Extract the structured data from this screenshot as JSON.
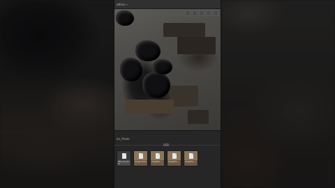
{
  "window": {
    "title": "athira ~"
  },
  "strip": {
    "label": "ito_Photo"
  },
  "thumbnails": [
    {
      "caption": "IMG_Cap_Phot"
    },
    {
      "caption": "Image_Photo ..."
    },
    {
      "caption": "ImageFile ..."
    },
    {
      "caption": "ImageFile ..."
    },
    {
      "caption": "ImageFile ..."
    }
  ],
  "icons": [
    "zoom-icon",
    "fit-icon",
    "rotate-icon",
    "info-icon",
    "menu-icon"
  ]
}
